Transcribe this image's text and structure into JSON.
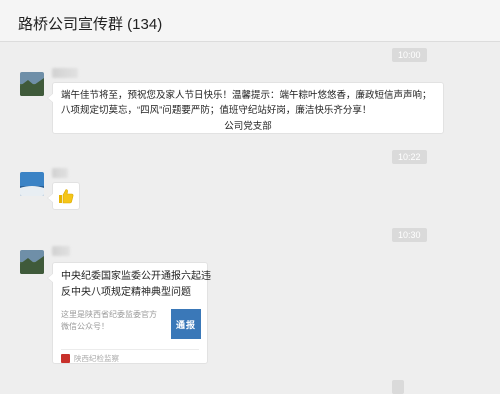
{
  "header": {
    "title": "路桥公司宣传群 (134)"
  },
  "messages": [
    {
      "time": "10:00",
      "text": "端午佳节将至，预祝您及家人节日快乐！温馨提示：端午粽叶悠悠香，廉政短信声声响；八项规定切莫忘，“四风”问题要严防；值班守纪站好岗，廉洁快乐齐分享！",
      "signature": "公司党支部"
    },
    {
      "time": "10:22",
      "emoji": "thumbs-up-icon"
    },
    {
      "time": "10:30",
      "card": {
        "title": "中央纪委国家监委公开通报六起违反中央八项规定精神典型问题",
        "description": "这里是陕西省纪委监委官方微信公众号！",
        "thumb_text": "通报",
        "thumb_color": "#3a78b8",
        "source": "陕西纪检监察"
      }
    }
  ]
}
